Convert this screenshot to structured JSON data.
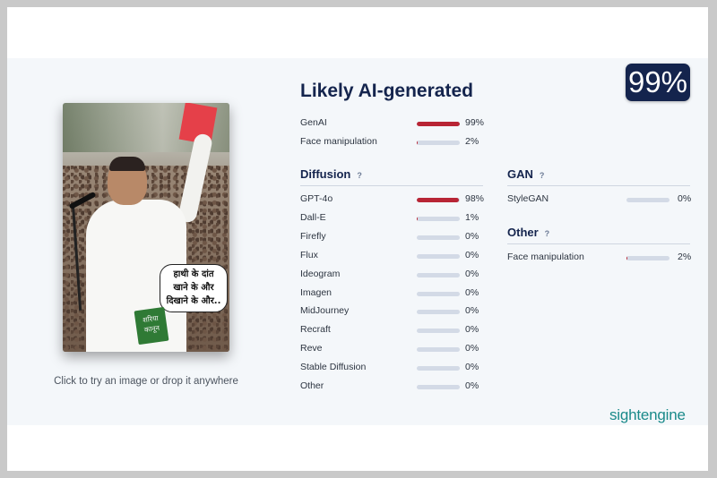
{
  "image_card": {
    "bubble_line1": "हाथी के दांत",
    "bubble_line2": "खाने के और",
    "bubble_line3": "दिखाने के और..",
    "book_line1": "शरिया",
    "book_line2": "कानून"
  },
  "hint": "Click to try an image or drop it anywhere",
  "title": "Likely AI-generated",
  "score": "99%",
  "colors": {
    "accent": "#14244d",
    "bar_fill": "#b82535",
    "bar_track": "#d3dae6",
    "brand": "#1a8a8a"
  },
  "summary": [
    {
      "label": "GenAI",
      "value": 0.99,
      "pct": "99%"
    },
    {
      "label": "Face manipulation",
      "value": 0.02,
      "pct": "2%"
    }
  ],
  "diffusion": {
    "heading": "Diffusion",
    "help": "?",
    "items": [
      {
        "label": "GPT-4o",
        "value": 0.98,
        "pct": "98%"
      },
      {
        "label": "Dall-E",
        "value": 0.01,
        "pct": "1%"
      },
      {
        "label": "Firefly",
        "value": 0,
        "pct": "0%"
      },
      {
        "label": "Flux",
        "value": 0,
        "pct": "0%"
      },
      {
        "label": "Ideogram",
        "value": 0,
        "pct": "0%"
      },
      {
        "label": "Imagen",
        "value": 0,
        "pct": "0%"
      },
      {
        "label": "MidJourney",
        "value": 0,
        "pct": "0%"
      },
      {
        "label": "Recraft",
        "value": 0,
        "pct": "0%"
      },
      {
        "label": "Reve",
        "value": 0,
        "pct": "0%"
      },
      {
        "label": "Stable Diffusion",
        "value": 0,
        "pct": "0%"
      },
      {
        "label": "Other",
        "value": 0,
        "pct": "0%"
      }
    ]
  },
  "gan": {
    "heading": "GAN",
    "help": "?",
    "items": [
      {
        "label": "StyleGAN",
        "value": 0,
        "pct": "0%"
      }
    ]
  },
  "other": {
    "heading": "Other",
    "help": "?",
    "items": [
      {
        "label": "Face manipulation",
        "value": 0.02,
        "pct": "2%"
      }
    ]
  },
  "brand": "sightengine"
}
